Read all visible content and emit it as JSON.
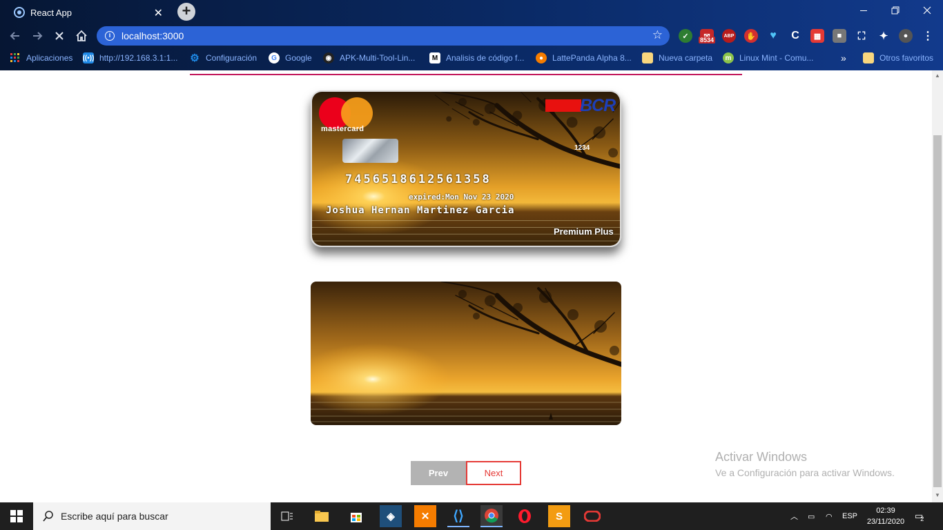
{
  "browser": {
    "tab_title": "React App",
    "tab_close": "✕",
    "new_tab": "+",
    "url": "localhost:3000",
    "ext_badge": "8534",
    "bookmarks": [
      {
        "label": "Aplicaciones",
        "icon": "apps-grid-icon",
        "color": "#e53935"
      },
      {
        "label": "http://192.168.3.1:1...",
        "icon": "router-icon",
        "color": "#1e88e5"
      },
      {
        "label": "Configuración",
        "icon": "gear-icon",
        "color": "#1e88e5"
      },
      {
        "label": "Google",
        "icon": "google-icon",
        "color": "#ffffff"
      },
      {
        "label": "APK-Multi-Tool-Lin...",
        "icon": "github-icon",
        "color": "#222222"
      },
      {
        "label": "Analisis de código f...",
        "icon": "medium-icon",
        "color": "#ffffff"
      },
      {
        "label": "LattePanda Alpha 8...",
        "icon": "lattepanda-icon",
        "color": "#f57c00"
      },
      {
        "label": "Nueva carpeta",
        "icon": "folder-icon",
        "color": "#f9d77e"
      },
      {
        "label": "Linux Mint - Comu...",
        "icon": "mint-icon",
        "color": "#8bc34a"
      }
    ],
    "more_bookmarks": "»",
    "other_favorites": "Otros favoritos"
  },
  "card": {
    "brand": "mastercard",
    "bank": "BCR",
    "cvv": "1234",
    "number": "7456518612561358",
    "expired": "expired:Mon Nov 23 2020",
    "holder": "Joshua Hernan Martinez Garcia",
    "tier": "Premium Plus"
  },
  "pager": {
    "prev": "Prev",
    "next": "Next"
  },
  "watermark": {
    "line1": "Activar Windows",
    "line2": "Ve a Configuración para activar Windows."
  },
  "taskbar": {
    "search_placeholder": "Escribe aquí para buscar",
    "language": "ESP",
    "time": "02:39",
    "date": "23/11/2020",
    "notifications": "2"
  }
}
